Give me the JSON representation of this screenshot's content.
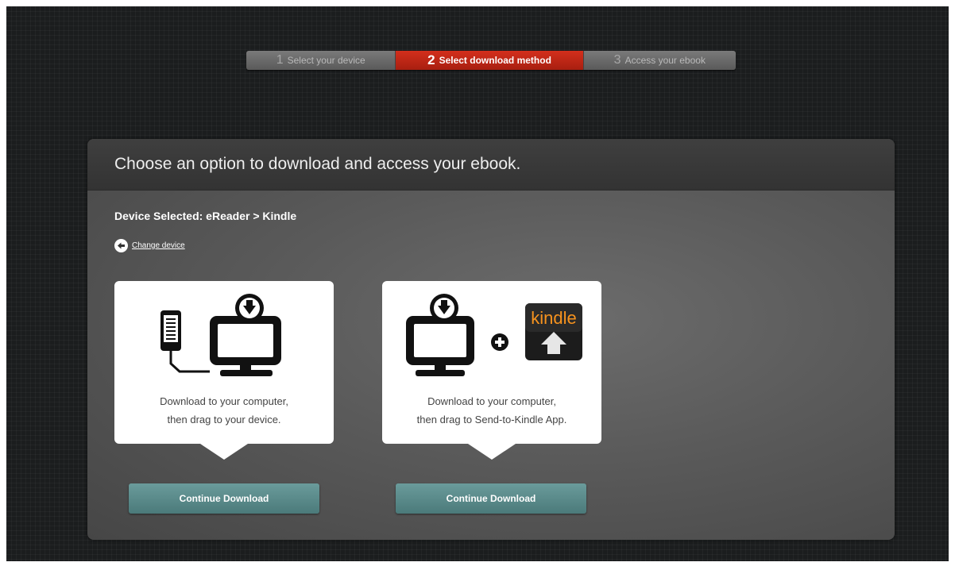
{
  "steps": [
    {
      "number": "1",
      "label": "Select your device",
      "state": "inactive"
    },
    {
      "number": "2",
      "label": "Select download method",
      "state": "active"
    },
    {
      "number": "3",
      "label": "Access your ebook",
      "state": "inactive"
    }
  ],
  "panel": {
    "heading": "Choose an option to download and access your ebook.",
    "device_selected": "Device Selected: eReader > Kindle",
    "change_device": "Change device"
  },
  "options": [
    {
      "line1": "Download to your computer,",
      "line2": "then drag to your device.",
      "button": "Continue Download",
      "icons": [
        "ereader-icon",
        "computer-download-icon"
      ]
    },
    {
      "line1": "Download to your computer,",
      "line2": "then drag to Send-to-Kindle App.",
      "button": "Continue Download",
      "icons": [
        "computer-download-icon",
        "plus-icon",
        "kindle-app-icon"
      ],
      "kindle_label": "kindle"
    }
  ],
  "colors": {
    "active_step": "#c4271a",
    "button": "#5a8a8a",
    "kindle_orange": "#f7931e"
  }
}
